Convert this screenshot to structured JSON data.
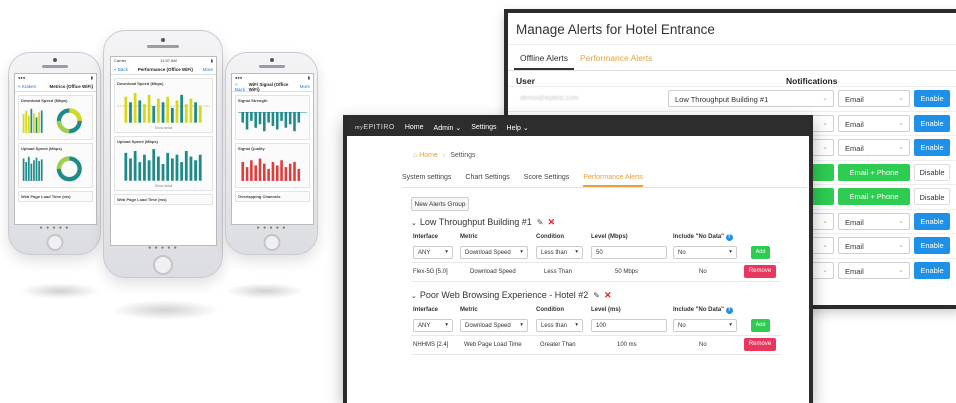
{
  "colors": {
    "accent_orange": "#e8a23b",
    "primary_blue": "#1e90e8",
    "success_green": "#2ecc51",
    "danger_red": "#e8365d",
    "topbar_dark": "#2d2d2d",
    "chart_teal": "#1f8a8a",
    "chart_yellow": "#d8d81a",
    "chart_red": "#e23b3b"
  },
  "phones": {
    "left": {
      "back": "< Kraken",
      "title": "Metrics (Office WiFi)",
      "cards": [
        "Download Speed (Mbps)",
        "Upload Speed (Mbps)",
        "Web Page Load Time (ms)"
      ]
    },
    "center": {
      "status_left": "Carrier",
      "status_time": "11:57 AM",
      "back": "< Back",
      "title": "Performance (Office WiFi)",
      "more": "More",
      "cards": [
        "Download Speed (Mbps)",
        "Upload Speed (Mbps)",
        "Web Page Load Time (ms)"
      ],
      "show_detail": "Show detail"
    },
    "right": {
      "back": "< Back",
      "title": "WiFi Signal (Office WiFi)",
      "more": "More",
      "cards": [
        "Signal Strength",
        "Signal Quality",
        "Overlapping Channels"
      ]
    }
  },
  "manage_alerts": {
    "title": "Manage Alerts for Hotel Entrance",
    "tabs": [
      "Offline Alerts",
      "Performance Alerts"
    ],
    "col_user": "User",
    "col_notifications": "Notifications",
    "user_email": "demo@epitiro.com",
    "rows": [
      {
        "group": "Low Throughput Building #1",
        "method": "Email",
        "action": "Enable"
      },
      {
        "group": "",
        "method": "Email",
        "action": "Enable"
      },
      {
        "group": "",
        "method": "Email",
        "action": "Enable"
      },
      {
        "green_label": "Email + Phone",
        "action": "Disable"
      },
      {
        "green_label": "Email + Phone",
        "action": "Disable"
      },
      {
        "group": "",
        "method": "Email",
        "action": "Enable"
      },
      {
        "group": "",
        "method": "Email",
        "action": "Enable"
      },
      {
        "group": "",
        "method": "Email",
        "action": "Enable"
      }
    ]
  },
  "settings": {
    "logo": "EPITIRO",
    "logo_prefix": "my",
    "nav": [
      "Home",
      "Admin",
      "Settings",
      "Help"
    ],
    "breadcrumb": {
      "home": "Home",
      "current": "Settings"
    },
    "tabs": [
      "System settings",
      "Chart Settings",
      "Score Settings",
      "Performance Alerts"
    ],
    "new_group_button": "New Alerts Group",
    "columns": [
      "Interface",
      "Metric",
      "Condition",
      "Level (Mbps)",
      "Include \"No Data\""
    ],
    "columns2": [
      "Interface",
      "Metric",
      "Condition",
      "Level (ms)",
      "Include \"No Data\""
    ],
    "groups": [
      {
        "name": "Low Throughput Building #1",
        "form": {
          "interface": "ANY",
          "metric": "Download Speed",
          "condition": "Less than",
          "level": "50",
          "no_data": "No",
          "add": "Add"
        },
        "row": {
          "interface": "Flex-5G [5.0]",
          "metric": "Download Speed",
          "condition": "Less Than",
          "level": "50 Mbps",
          "no_data": "No",
          "remove": "Remove"
        }
      },
      {
        "name": "Poor Web Browsing Experience - Hotel #2",
        "form": {
          "interface": "ANY",
          "metric": "Download Speed",
          "condition": "Less than",
          "level": "100",
          "no_data": "No",
          "add": "Add"
        },
        "row": {
          "interface": "NHHMS [2.4]",
          "metric": "Web Page Load Time",
          "condition": "Greater Than",
          "level": "100 ms",
          "no_data": "No",
          "remove": "Remove"
        }
      }
    ]
  }
}
